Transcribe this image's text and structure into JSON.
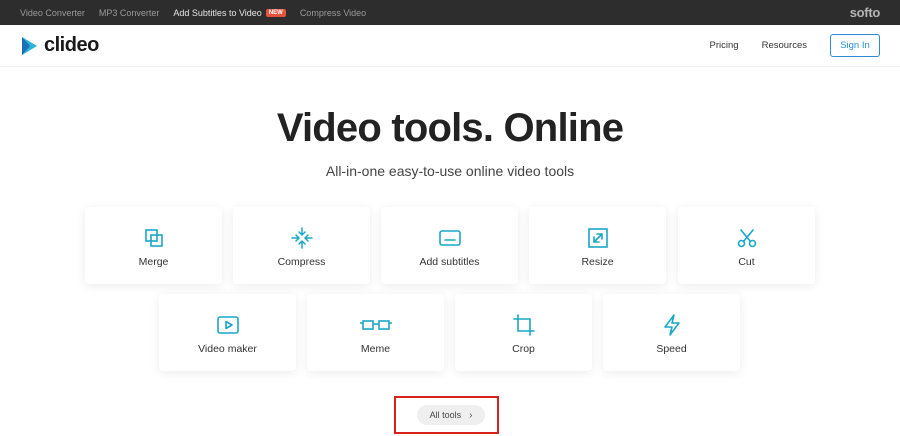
{
  "topbar": {
    "links": [
      "Video Converter",
      "MP3 Converter",
      "Add Subtitles to Video",
      "Compress Video"
    ],
    "new_badge": "NEW",
    "brand": "softo"
  },
  "header": {
    "logo_text": "clideo",
    "nav": [
      "Pricing",
      "Resources"
    ],
    "signin_label": "Sign In"
  },
  "hero": {
    "title": "Video tools. Online",
    "subtitle": "All-in-one easy-to-use online video tools"
  },
  "tools": [
    {
      "label": "Merge",
      "icon": "merge-icon"
    },
    {
      "label": "Compress",
      "icon": "compress-icon"
    },
    {
      "label": "Add subtitles",
      "icon": "subtitles-icon"
    },
    {
      "label": "Resize",
      "icon": "resize-icon"
    },
    {
      "label": "Cut",
      "icon": "scissors-icon"
    },
    {
      "label": "Video maker",
      "icon": "video-maker-icon"
    },
    {
      "label": "Meme",
      "icon": "meme-icon"
    },
    {
      "label": "Crop",
      "icon": "crop-icon"
    },
    {
      "label": "Speed",
      "icon": "lightning-icon"
    }
  ],
  "all_tools_label": "All tools",
  "colors": {
    "accent": "#1aa7c8",
    "topbar": "#2d2d2d",
    "signin": "#2b8cd8",
    "highlight": "#d9221c"
  }
}
